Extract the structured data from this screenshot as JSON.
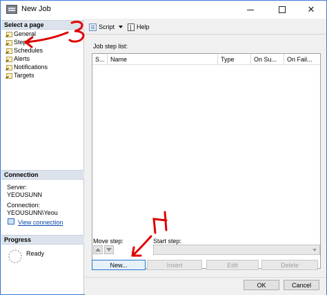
{
  "window": {
    "title": "New Job"
  },
  "sidebar": {
    "select_page_header": "Select a page",
    "items": [
      {
        "label": "General"
      },
      {
        "label": "Steps"
      },
      {
        "label": "Schedules"
      },
      {
        "label": "Alerts"
      },
      {
        "label": "Notifications"
      },
      {
        "label": "Targets"
      }
    ],
    "connection_header": "Connection",
    "server_label": "Server:",
    "server_value": "YEOUSUNN",
    "connection_label": "Connection:",
    "connection_value": "YEOUSUNN\\Yeou",
    "view_connection_link": "View connection",
    "progress_header": "Progress",
    "progress_status": "Ready"
  },
  "toolbar": {
    "script_label": "Script",
    "help_label": "Help"
  },
  "main": {
    "job_step_list_label": "Job step list:",
    "columns": [
      "S...",
      "Name",
      "Type",
      "On Su...",
      "On Fail..."
    ],
    "rows": [],
    "move_step_label": "Move step:",
    "start_step_label": "Start step:",
    "start_step_value": "",
    "buttons": {
      "new": "New...",
      "insert": "Insert",
      "edit": "Edit",
      "delete": "Delete"
    }
  },
  "footer": {
    "ok": "OK",
    "cancel": "Cancel"
  },
  "annotations": {
    "label_3": "3",
    "label_4": "4",
    "color": "#e00000"
  }
}
